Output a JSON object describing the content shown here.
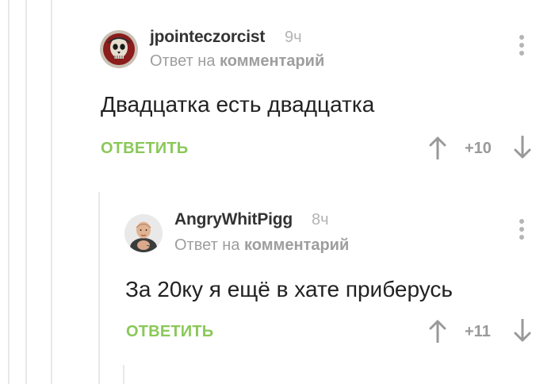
{
  "comments": [
    {
      "username": "jpointeczorcist",
      "time": "9ч",
      "reply_prefix": "Ответ на",
      "reply_target": "комментарий",
      "text": "Двадцатка есть двадцатка",
      "reply_button": "ОТВЕТИТЬ",
      "rating": "+10",
      "avatar_icon": "skull-icon"
    },
    {
      "username": "AngryWhitPigg",
      "time": "8ч",
      "reply_prefix": "Ответ на",
      "reply_target": "комментарий",
      "text": "За 20ку я ещё в хате приберусь",
      "reply_button": "ОТВЕТИТЬ",
      "rating": "+11",
      "avatar_icon": "user-photo-icon"
    }
  ],
  "colors": {
    "accent_green": "#8ac858",
    "thread_line": "#e8e8e8",
    "muted_text": "#9e9e9e"
  }
}
